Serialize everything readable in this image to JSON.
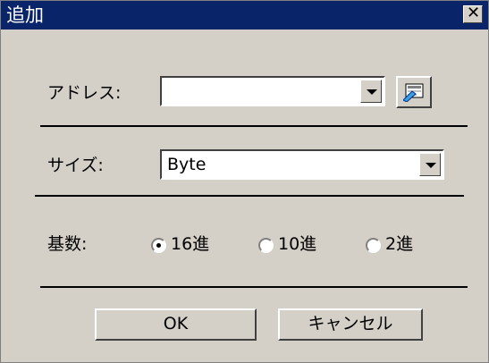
{
  "window": {
    "title": "追加",
    "close_glyph": "✕"
  },
  "address": {
    "label": "アドレス:",
    "value": ""
  },
  "size": {
    "label": "サイズ:",
    "selected": "Byte"
  },
  "radix": {
    "label": "基数:",
    "options": [
      {
        "label": "16進",
        "selected": true
      },
      {
        "label": "10進",
        "selected": false
      },
      {
        "label": "2進",
        "selected": false
      }
    ]
  },
  "buttons": {
    "ok": "OK",
    "cancel": "キャンセル"
  }
}
